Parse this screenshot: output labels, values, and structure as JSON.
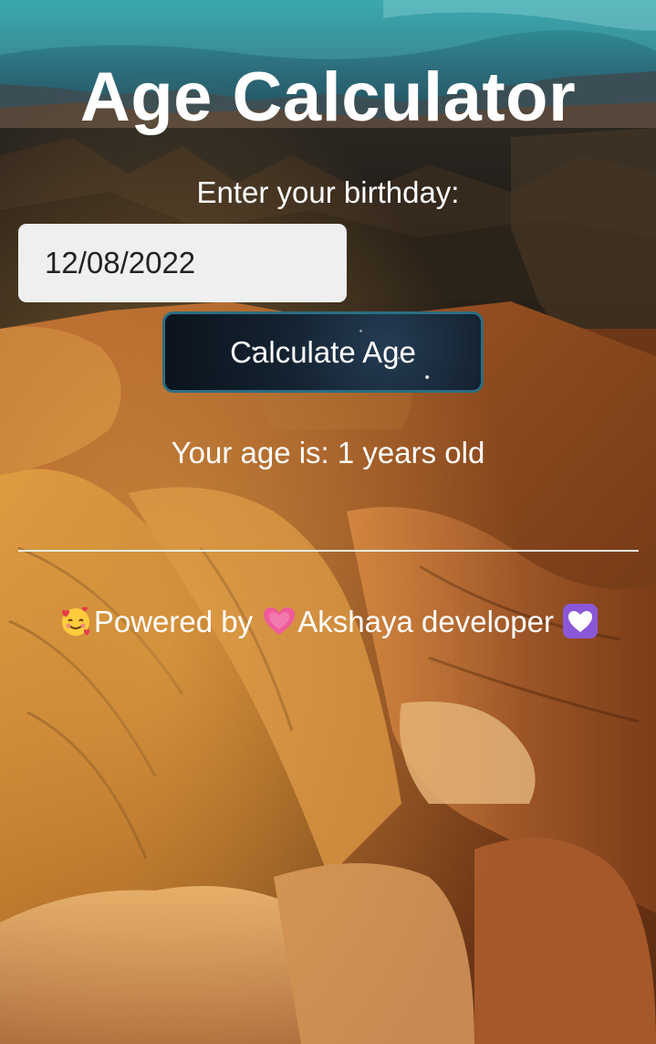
{
  "page": {
    "title": "Age Calculator"
  },
  "form": {
    "label": "Enter your birthday:",
    "birthday_value": "12/08/2022",
    "calculate_label": "Calculate Age"
  },
  "result": {
    "text": "Your age is: 1 years old"
  },
  "footer": {
    "powered_by_label": "Powered by",
    "developer_name": "Akshaya developer",
    "icons": [
      "smiling-face-with-hearts-icon",
      "growing-heart-icon",
      "white-heart-icon"
    ]
  },
  "colors": {
    "text": "#ffffff",
    "input_background": "#efefef",
    "button_border": "#2d6e82",
    "button_background": "#142231",
    "divider": "#ffffff"
  }
}
